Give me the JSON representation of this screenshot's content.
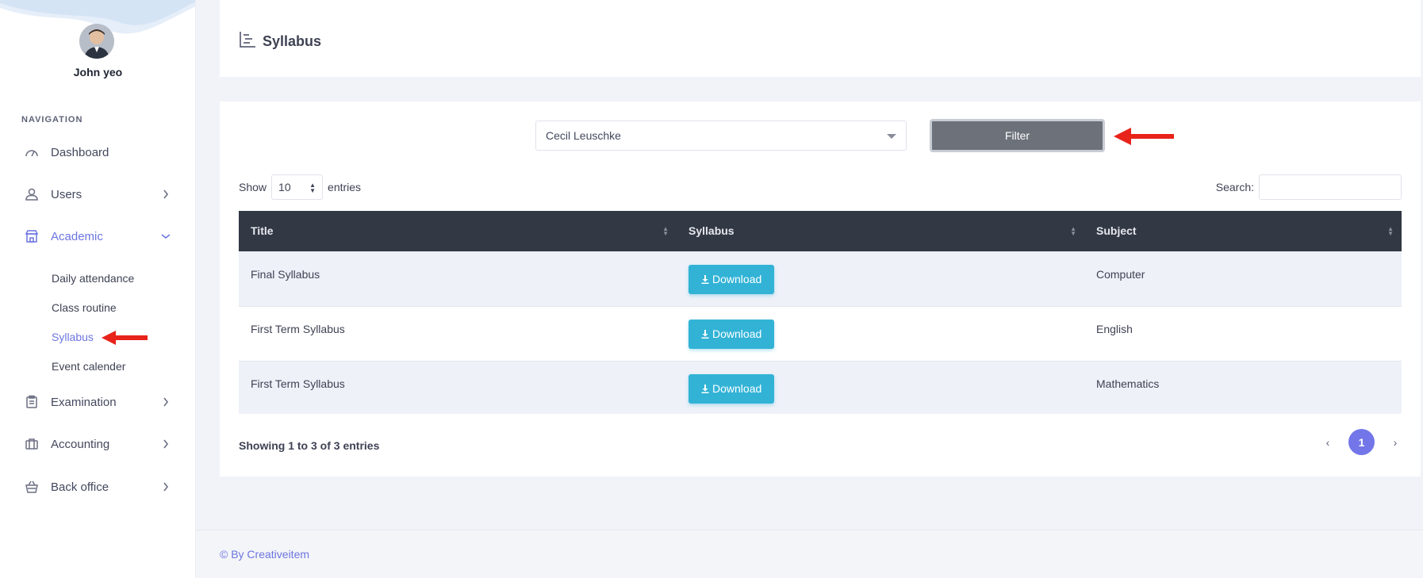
{
  "user": {
    "name": "John yeo"
  },
  "nav": {
    "heading": "NAVIGATION",
    "items": [
      {
        "label": "Dashboard",
        "icon": "speedometer-icon"
      },
      {
        "label": "Users",
        "icon": "user-icon"
      },
      {
        "label": "Academic",
        "icon": "school-icon"
      },
      {
        "label": "Examination",
        "icon": "clipboard-icon"
      },
      {
        "label": "Accounting",
        "icon": "briefcase-icon"
      },
      {
        "label": "Back office",
        "icon": "basket-icon"
      }
    ],
    "academic_sub": [
      "Daily attendance",
      "Class routine",
      "Syllabus",
      "Event calender"
    ]
  },
  "header": {
    "title": "Syllabus"
  },
  "filter": {
    "selected": "Cecil Leuschke",
    "button_label": "Filter"
  },
  "table_controls": {
    "show_label": "Show",
    "entries_value": "10",
    "entries_label": "entries",
    "search_label": "Search:"
  },
  "table": {
    "columns": [
      "Title",
      "Syllabus",
      "Subject"
    ],
    "rows": [
      {
        "title": "Final Syllabus",
        "action": "Download",
        "subject": "Computer"
      },
      {
        "title": "First Term Syllabus",
        "action": "Download",
        "subject": "English"
      },
      {
        "title": "First Term Syllabus",
        "action": "Download",
        "subject": "Mathematics"
      }
    ]
  },
  "info": "Showing 1 to 3 of 3 entries",
  "pagination": {
    "prev": "‹",
    "current": "1",
    "next": "›"
  },
  "footer": "© By Creativeitem",
  "colors": {
    "accent": "#6c75e0",
    "download": "#32b3d6",
    "table_header": "#323844",
    "filter_btn": "#6c717a",
    "annotation_arrow": "#e8231a"
  }
}
